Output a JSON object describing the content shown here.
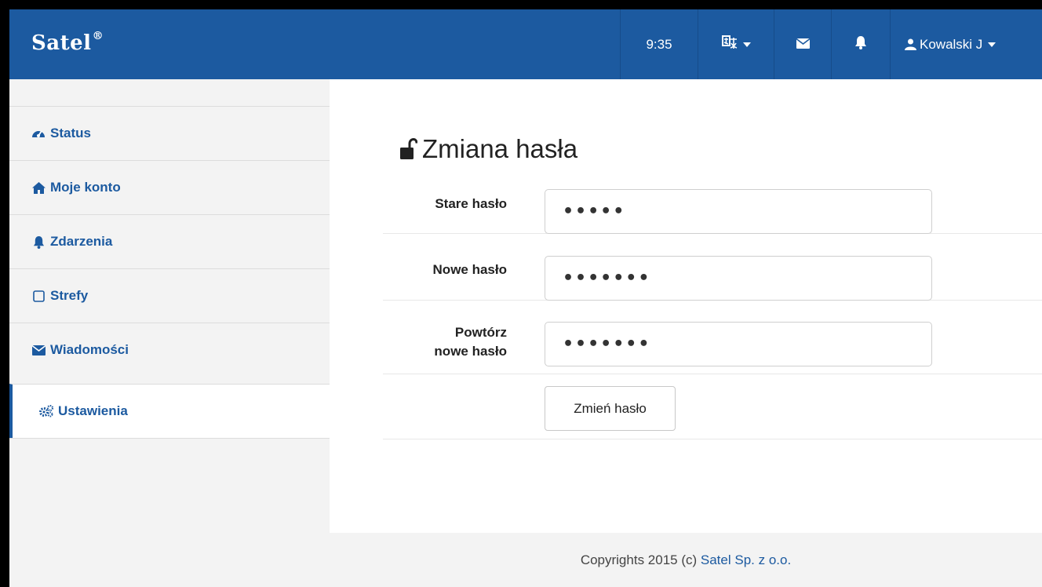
{
  "header": {
    "logo": "Satel",
    "logo_mark": "®",
    "time": "9:35",
    "language_icon": "language-icon",
    "messages_icon": "envelope-icon",
    "notifications_icon": "bell-icon",
    "user_name": "Kowalski J"
  },
  "sidebar": {
    "items": [
      {
        "label": "Status",
        "icon": "dashboard-icon"
      },
      {
        "label": "Moje konto",
        "icon": "home-icon"
      },
      {
        "label": "Zdarzenia",
        "icon": "bell-icon"
      },
      {
        "label": "Strefy",
        "icon": "square-icon"
      },
      {
        "label": "Wiadomości",
        "icon": "envelope-icon"
      },
      {
        "label": "Ustawienia",
        "icon": "gears-icon",
        "active": true
      }
    ]
  },
  "main": {
    "title": "Zmiana hasła",
    "title_icon": "unlock-icon",
    "fields": [
      {
        "label": "Stare hasło",
        "value": "•••••"
      },
      {
        "label": "Nowe hasło",
        "value": "•••••••"
      },
      {
        "label_line1": "Powtórz",
        "label_line2": "nowe hasło",
        "value": "•••••••"
      }
    ],
    "submit_label": "Zmień hasło"
  },
  "footer": {
    "text": "Copyrights 2015 (c) ",
    "link": "Satel Sp. z o.o."
  },
  "colors": {
    "brand": "#1c5aa0",
    "background": "#f3f3f3"
  }
}
